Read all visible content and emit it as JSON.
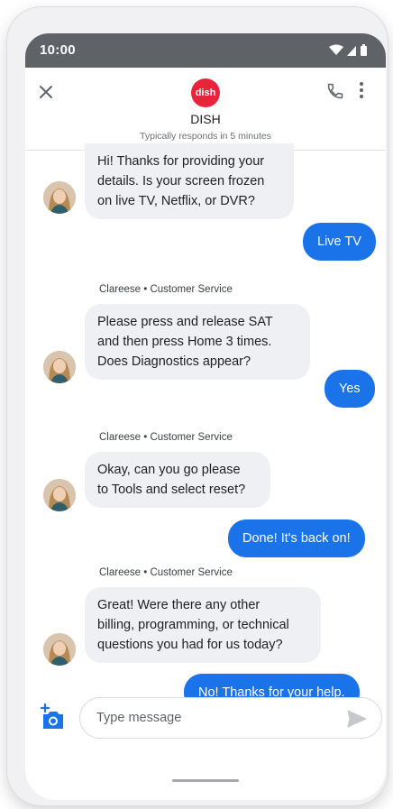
{
  "status_bar": {
    "time": "10:00"
  },
  "header": {
    "logo_text": "dish",
    "business_name": "DISH",
    "response_time": "Typically responds in 5 minutes"
  },
  "messages": [
    {
      "from": "agent",
      "text_lines": [
        "Hi! Thanks for providing your",
        "details. Is your screen frozen",
        "on live TV, Netflix, or DVR?"
      ]
    },
    {
      "from": "user",
      "text": "Live TV"
    },
    {
      "from": "agent",
      "sender": "Clareese",
      "role": "Customer Service",
      "text_lines": [
        "Please press and release SAT",
        "and then press Home 3 times.",
        "Does Diagnostics appear?"
      ]
    },
    {
      "from": "user",
      "text": "Yes"
    },
    {
      "from": "agent",
      "sender": "Clareese",
      "role": "Customer Service",
      "text_lines": [
        "Okay, can you go please",
        "to Tools and select reset?"
      ]
    },
    {
      "from": "user",
      "text": "Done! It's back on!"
    },
    {
      "from": "agent",
      "sender": "Clareese",
      "role": "Customer Service",
      "text_lines": [
        "Great! Were there any other",
        "billing, programming, or technical",
        "questions you had for us today?"
      ]
    },
    {
      "from": "user",
      "text": "No! Thanks for your help."
    }
  ],
  "sender_separator": "•",
  "composer": {
    "placeholder": "Type message"
  },
  "colors": {
    "accent": "#1a73e8",
    "brand": "#e8243a",
    "incoming_bubble": "#eef0f3",
    "status_bar": "#5f6368"
  },
  "icons": [
    "close-icon",
    "phone-icon",
    "more-vert-icon",
    "add-photo-icon",
    "send-icon",
    "wifi-icon",
    "signal-icon",
    "battery-icon"
  ]
}
